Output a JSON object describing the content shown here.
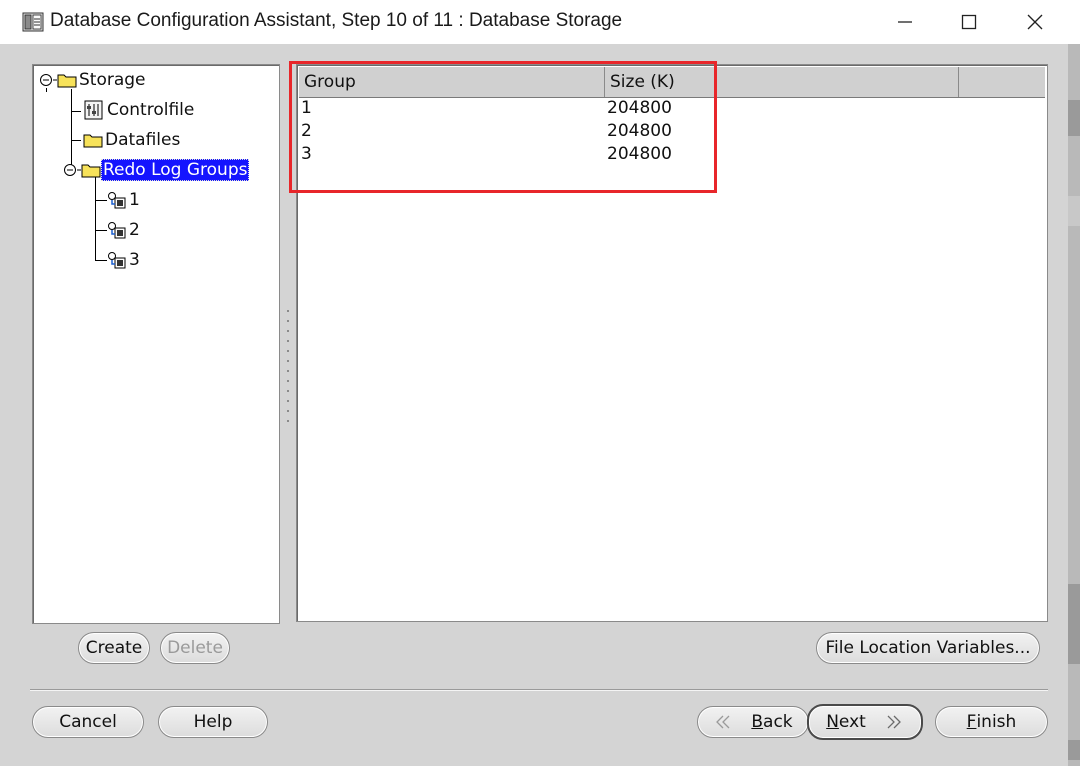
{
  "window": {
    "title": "Database Configuration Assistant, Step 10 of 11 : Database Storage",
    "icon": "database-icon",
    "controls": [
      "minimize-icon",
      "maximize-icon",
      "close-icon"
    ]
  },
  "tree": {
    "root": {
      "label": "Storage",
      "icon": "folder-icon",
      "expanded": true
    },
    "items": [
      {
        "label": "Controlfile",
        "icon": "controlfile-icon"
      },
      {
        "label": "Datafiles",
        "icon": "folder-icon"
      },
      {
        "label": "Redo Log Groups",
        "icon": "folder-icon",
        "expanded": true,
        "selected": true
      }
    ],
    "redo_groups": [
      {
        "label": "1",
        "icon": "redo-log-icon"
      },
      {
        "label": "2",
        "icon": "redo-log-icon"
      },
      {
        "label": "3",
        "icon": "redo-log-icon"
      }
    ],
    "create_label": "Create",
    "delete_label": "Delete"
  },
  "table": {
    "columns": [
      "Group",
      "Size (K)"
    ],
    "rows": [
      {
        "group": "1",
        "size": "204800"
      },
      {
        "group": "2",
        "size": "204800"
      },
      {
        "group": "3",
        "size": "204800"
      }
    ]
  },
  "buttons": {
    "file_location": "File Location Variables...",
    "cancel": "Cancel",
    "help": "Help",
    "back_first": "B",
    "back_rest": "ack",
    "next_first": "N",
    "next_rest": "ext",
    "finish_first": "F",
    "finish_rest": "inish"
  },
  "colors": {
    "selection": "#1414ff",
    "annotation": "#e8262a",
    "folder": "#f7e25a"
  }
}
